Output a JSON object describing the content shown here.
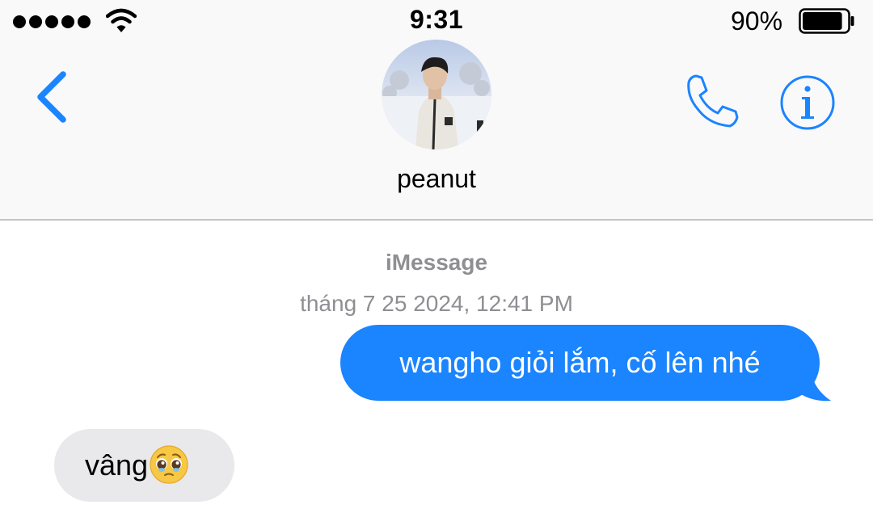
{
  "status_bar": {
    "signal_icon": "signal-dots-icon",
    "wifi_icon": "wifi-icon",
    "time": "9:31",
    "battery_percent": "90%",
    "battery_level": 0.9,
    "battery_icon": "battery-icon"
  },
  "header": {
    "back_icon": "chevron-left-icon",
    "contact_name": "peanut",
    "avatar": "contact-avatar-photo",
    "phone_icon": "phone-icon",
    "info_icon": "info-icon",
    "accent_color": "#1b84ff",
    "background_color": "#f9f9f9"
  },
  "conversation": {
    "service": "iMessage",
    "timestamp": "tháng 7 25 2024, 12:41 PM",
    "messages": [
      {
        "direction": "outgoing",
        "text": "wangho giỏi lắm, cố lên nhé",
        "color": "#1b84ff"
      },
      {
        "direction": "incoming",
        "text": "vâng",
        "emoji": "pleading-face-icon",
        "color": "#e9e9eb"
      }
    ]
  }
}
